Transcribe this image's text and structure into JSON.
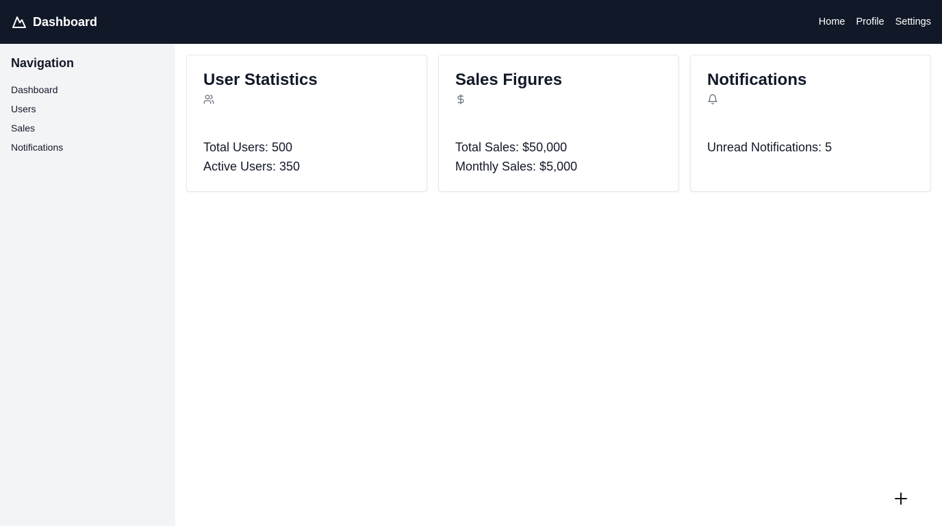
{
  "header": {
    "title": "Dashboard",
    "logo_icon": "mountain-icon",
    "nav": [
      {
        "label": "Home"
      },
      {
        "label": "Profile"
      },
      {
        "label": "Settings"
      }
    ]
  },
  "sidebar": {
    "heading": "Navigation",
    "items": [
      {
        "label": "Dashboard"
      },
      {
        "label": "Users"
      },
      {
        "label": "Sales"
      },
      {
        "label": "Notifications"
      }
    ]
  },
  "cards": [
    {
      "title": "User Statistics",
      "icon": "users-icon",
      "lines": [
        "Total Users: 500",
        "Active Users: 350"
      ]
    },
    {
      "title": "Sales Figures",
      "icon": "dollar-icon",
      "lines": [
        "Total Sales: $50,000",
        "Monthly Sales: $5,000"
      ]
    },
    {
      "title": "Notifications",
      "icon": "bell-icon",
      "lines": [
        "Unread Notifications: 5"
      ]
    }
  ],
  "fab": {
    "icon": "plus-icon"
  },
  "colors": {
    "header_bg": "#111827",
    "sidebar_bg": "#f3f4f6",
    "card_border": "#e5e7eb"
  }
}
